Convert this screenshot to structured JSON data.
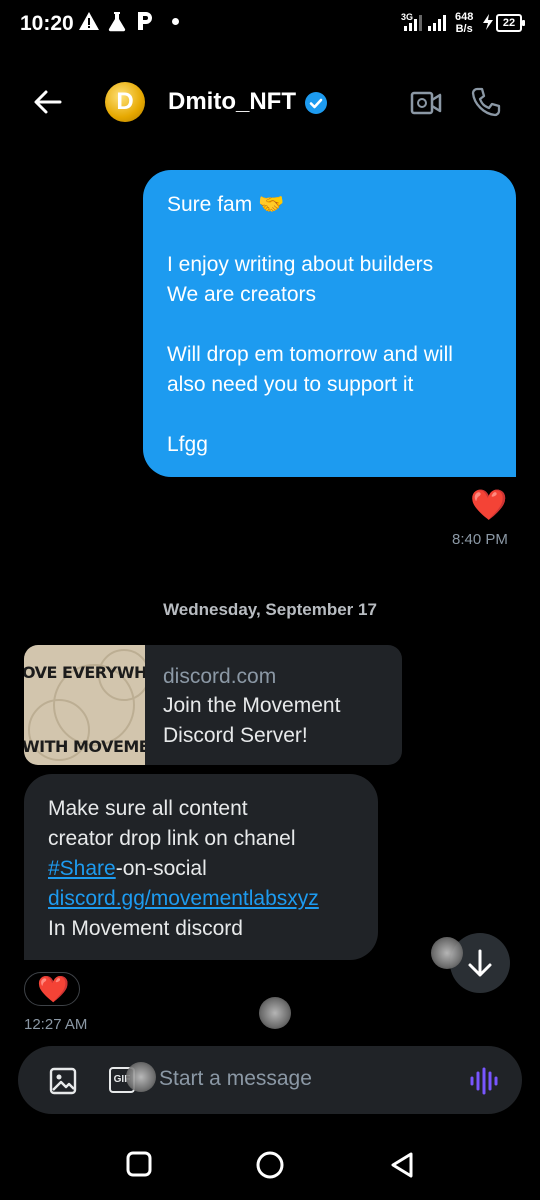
{
  "status_bar": {
    "time": "10:20",
    "icons_left": [
      "warning-icon",
      "flask-icon",
      "p-icon",
      "dot-icon"
    ],
    "network_type": "3G",
    "speed_value": "648",
    "speed_unit": "B/s",
    "battery": "22"
  },
  "header": {
    "title": "Dmito_NFT",
    "avatar_letter": "D",
    "verified": true
  },
  "messages": {
    "outgoing": {
      "text": "Sure fam 🤝\n\nI enjoy writing about builders\nWe are creators\n\nWill drop em tomorrow and will also need you to support it\n\nLfgg",
      "time": "8:40 PM",
      "reaction": "❤️"
    },
    "date_separator": "Wednesday, September 17",
    "link_card": {
      "domain": "discord.com",
      "title": "Join the Movement Discord Server!",
      "thumb_line1": "OVE EVERYWHE",
      "thumb_line2": "WITH MOVEMEN"
    },
    "incoming": {
      "line1": "Make sure all content",
      "line2": "creator drop link on chanel",
      "hashtag": "#Share",
      "hashtag_rest": "-on-social",
      "link": "discord.gg/movementlabsxyz",
      "line5": "In Movement discord",
      "time": "12:27 AM",
      "reaction": "❤️"
    }
  },
  "composer": {
    "placeholder": "Start a message",
    "gif_label": "GIF"
  },
  "colors": {
    "accent": "#1d9bf0",
    "voice": "#7856ff",
    "heart": "#f91880"
  }
}
